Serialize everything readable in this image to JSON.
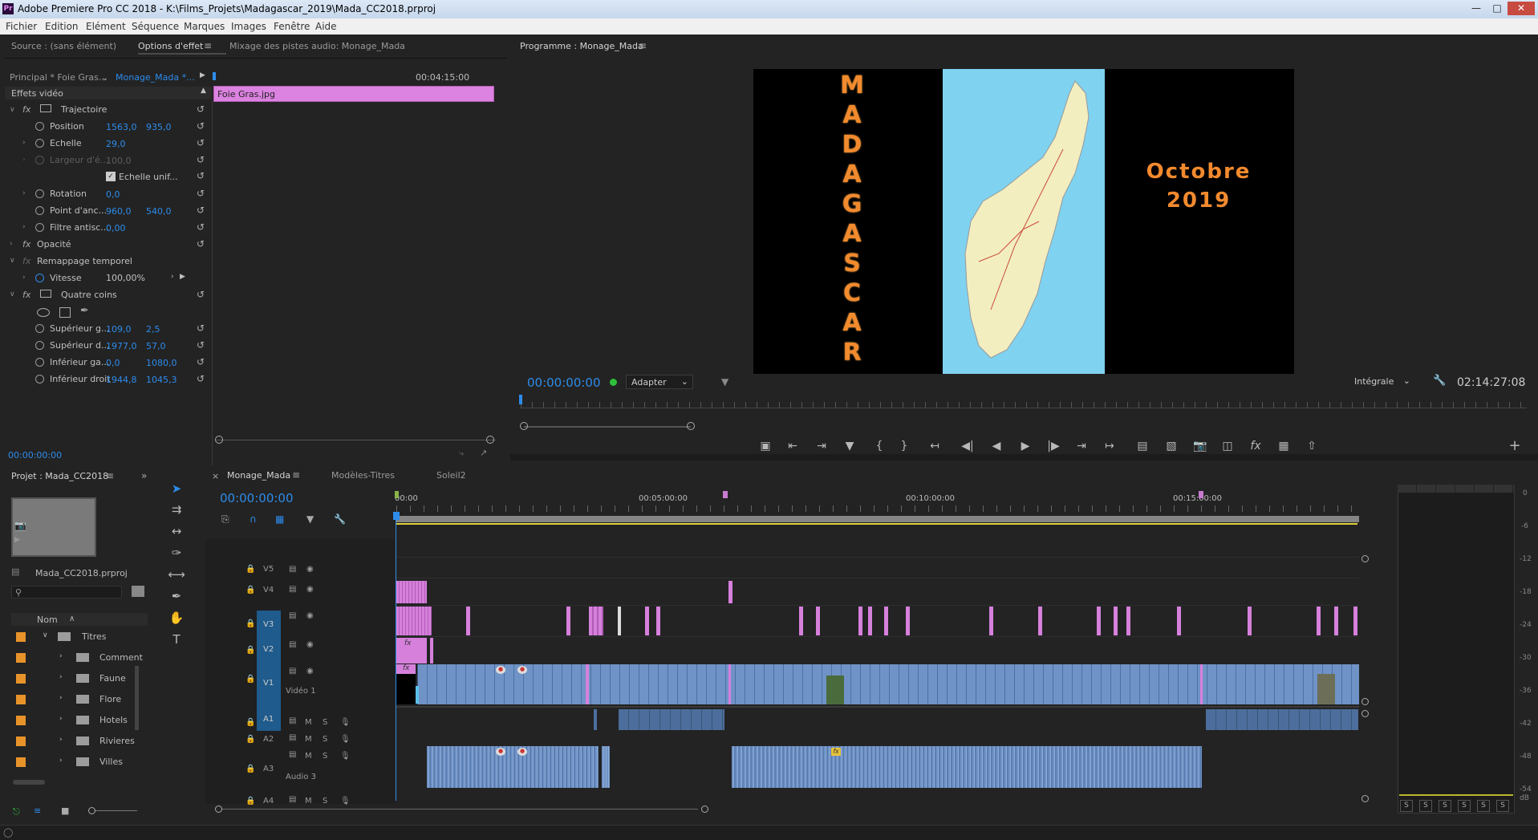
{
  "app": {
    "title": "Adobe Premiere Pro CC 2018 - K:\\Films_Projets\\Madagascar_2019\\Mada_CC2018.prproj",
    "icon_label": "Pr",
    "window_controls": [
      "minimize-icon",
      "maximize-icon",
      "close-icon"
    ]
  },
  "menu": [
    "Fichier",
    "Edition",
    "Elément",
    "Séquence",
    "Marques",
    "Images",
    "Fenêtre",
    "Aide"
  ],
  "effects_panel": {
    "tabs": [
      "Source : (sans élément)",
      "Options d'effet",
      "Mixage des pistes audio: Monage_Mada"
    ],
    "master_clip": "Principal * Foie Gras...",
    "sequence_clip": "Monage_Mada *...",
    "time_end": "00:04:15:00",
    "clip_name": "Foie Gras.jpg",
    "section": "Effets vidéo",
    "effects": [
      {
        "name": "Trajectoire",
        "props": [
          {
            "label": "Position",
            "v1": "1563,0",
            "v2": "935,0"
          },
          {
            "label": "Echelle",
            "v1": "29,0",
            "v2": ""
          },
          {
            "label": "Largeur d'é...",
            "v1": "100,0",
            "v2": "",
            "disabled": true
          },
          {
            "label": "Echelle unif...",
            "checkbox": true
          },
          {
            "label": "Rotation",
            "v1": "0,0",
            "v2": ""
          },
          {
            "label": "Point d'anc...",
            "v1": "960,0",
            "v2": "540,0"
          },
          {
            "label": "Filtre antisc...",
            "v1": "0,00",
            "v2": ""
          }
        ]
      },
      {
        "name": "Opacité"
      },
      {
        "name": "Remappage temporel",
        "props": [
          {
            "label": "Vitesse",
            "v1": "100,00%",
            "v2": ""
          }
        ]
      },
      {
        "name": "Quatre coins",
        "props": [
          {
            "label": "Supérieur g...",
            "v1": "109,0",
            "v2": "2,5"
          },
          {
            "label": "Supérieur d...",
            "v1": "1977,0",
            "v2": "57,0"
          },
          {
            "label": "Inférieur ga...",
            "v1": "0,0",
            "v2": "1080,0"
          },
          {
            "label": "Inférieur droit",
            "v1": "1944,8",
            "v2": "1045,3"
          }
        ]
      }
    ],
    "timecode": "00:00:00:00"
  },
  "program_monitor": {
    "title": "Programme : Monage_Mada",
    "left_text": [
      "M",
      "A",
      "D",
      "A",
      "G",
      "A",
      "S",
      "C",
      "A",
      "R"
    ],
    "right_line1": "Octobre",
    "right_line2": "2019",
    "timecode": "00:00:00:00",
    "fit": "Adapter",
    "quality": "Intégrale",
    "duration": "02:14:27:08"
  },
  "project_panel": {
    "title": "Projet : Mada_CC2018",
    "filename": "Mada_CC2018.prproj",
    "column": "Nom",
    "root": "Titres",
    "folders": [
      "Comment",
      "Faune",
      "Flore",
      "Hotels",
      "Rivieres",
      "Villes"
    ],
    "color": "#e8932a"
  },
  "timeline": {
    "tabs": [
      "Monage_Mada",
      "Modèles-Titres",
      "Soleil2"
    ],
    "timecode": "00:00:00:00",
    "ruler": [
      "00:00",
      "00:05:00:00",
      "00:10:00:00",
      "00:15:00:00"
    ],
    "video_tracks": [
      "V5",
      "V4",
      "V3",
      "V2",
      "V1"
    ],
    "v1_name": "Vidéo 1",
    "audio_tracks": [
      "A1",
      "A2",
      "A3",
      "A4"
    ],
    "a3_name": "Audio 3",
    "m_label": "M",
    "s_label": "S",
    "fx_badge": "fx",
    "clip_color_video": "#6f93c6",
    "clip_color_title": "#d680dc"
  },
  "audio_meter": {
    "scale": [
      "0",
      "-6",
      "-12",
      "-18",
      "-24",
      "-30",
      "-36",
      "-42",
      "-48",
      "-54",
      "dB"
    ],
    "solo": [
      "S",
      "S",
      "S",
      "S",
      "S",
      "S"
    ]
  }
}
